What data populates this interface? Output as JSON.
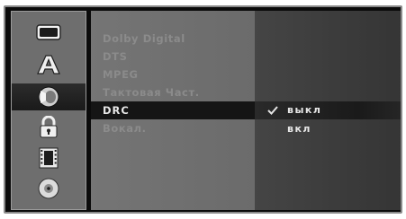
{
  "menu_icons": [
    "tv-icon",
    "language-icon",
    "speaker-icon",
    "lock-icon",
    "film-icon",
    "disc-icon"
  ],
  "active_icon_index": 2,
  "settings": [
    {
      "label": "Dolby Digital"
    },
    {
      "label": "DTS"
    },
    {
      "label": "MPEG"
    },
    {
      "label": "Тактовая Част."
    },
    {
      "label": "DRC"
    },
    {
      "label": "Вокал."
    }
  ],
  "options": {
    "selected": "выкл",
    "other": "вкл"
  },
  "colors": {
    "selected_row": "#151515",
    "text_inactive": "#8b8b8b",
    "text_active": "#e8e8e8"
  }
}
